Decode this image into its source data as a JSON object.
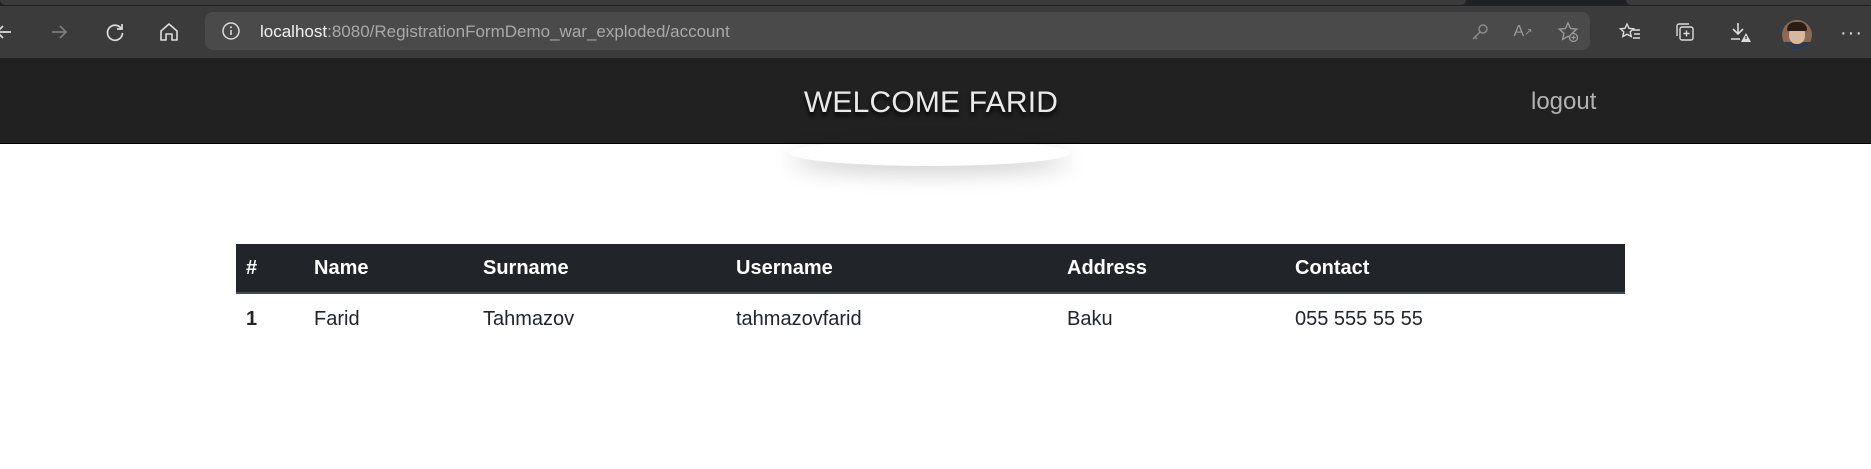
{
  "browser": {
    "url_host": "localhost",
    "url_path": ":8080/RegistrationFormDemo_war_exploded/account",
    "read_aloud_label": "A",
    "icons": {
      "back": "back-arrow-icon",
      "forward": "forward-arrow-icon",
      "reload": "reload-icon",
      "home": "home-icon",
      "site_info": "info-icon",
      "password": "key-icon",
      "favorite_add": "star-add-icon",
      "favorites": "favorites-list-icon",
      "collections": "collections-icon",
      "downloads": "download-warning-icon",
      "more": "more-icon"
    }
  },
  "header": {
    "welcome_text": "WELCOME FARID",
    "logout_label": "logout",
    "background": "#212121"
  },
  "table": {
    "columns": [
      "#",
      "Name",
      "Surname",
      "Username",
      "Address",
      "Contact"
    ],
    "rows": [
      [
        "1",
        "Farid",
        "Tahmazov",
        "tahmazovfarid",
        "Baku",
        "055 555 55 55"
      ]
    ],
    "header_color": "#212529"
  }
}
